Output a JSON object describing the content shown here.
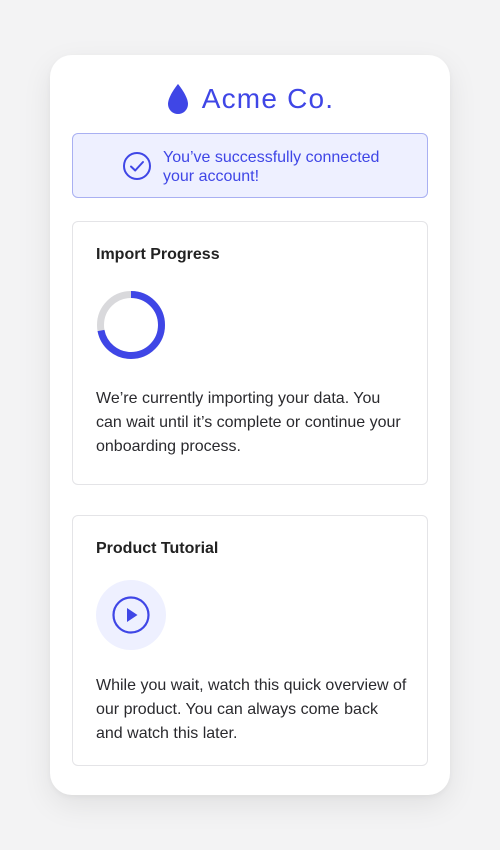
{
  "brand": {
    "name": "Acme Co.",
    "logo_icon": "water-drop-icon",
    "color": "#3f46e6"
  },
  "alert": {
    "icon": "check-circle-icon",
    "message": "You’ve successfully connected your account!",
    "background": "#eef0ff",
    "border": "#a9b0f2"
  },
  "import_progress": {
    "title": "Import Progress",
    "progress": 0.72,
    "track_color": "#d9d9dc",
    "fill_color": "#3f46e6",
    "description": "We’re currently importing your data. You can wait until it’s complete or continue your onboarding process."
  },
  "product_tutorial": {
    "title": "Product Tutorial",
    "play_icon": "play-circle-icon",
    "description": "While you wait, watch this quick overview of our product. You can always come back and watch this later."
  }
}
